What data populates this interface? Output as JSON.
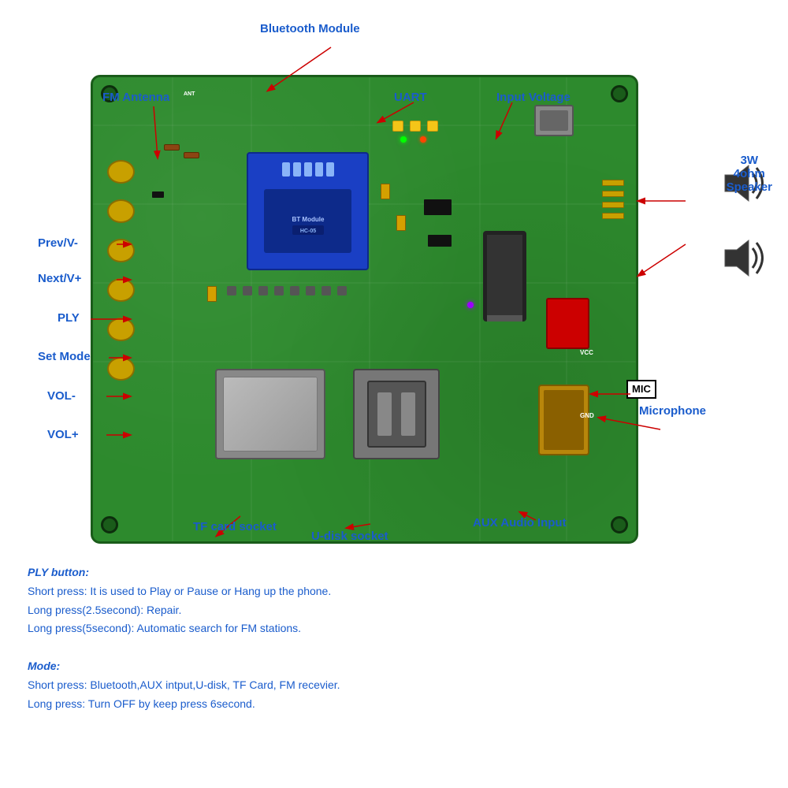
{
  "labels": {
    "bluetooth_module": "Bluetooth Module",
    "fm_antenna": "FM Antenna",
    "uart": "UART",
    "input_voltage": "Input Voltage",
    "prev_v_minus": "Prev/V-",
    "next_v_plus": "Next/V+",
    "ply": "PLY",
    "set_mode": "Set Mode",
    "vol_minus": "VOL-",
    "vol_plus": "VOL+",
    "speaker_label": "3W\n4ohm\nSpeaker",
    "speaker_line1": "3W",
    "speaker_line2": "4ohm",
    "speaker_line3": "Speaker",
    "mic_label": "MIC",
    "microphone": "Microphone",
    "tf_card_socket": "TF card socket",
    "u_disk_socket": "U-disk socket",
    "aux_audio_input": "AUX Audio Input"
  },
  "description": {
    "ply_button_title": "PLY button:",
    "ply_short_press": "Short press: It is used to Play or Pause or Hang up the phone.",
    "ply_long_press_1": "Long press(2.5second): Repair.",
    "ply_long_press_2": "Long press(5second): Automatic search for FM stations.",
    "mode_title": "Mode:",
    "mode_short_press": "Short press: Bluetooth,AUX intput,U-disk, TF Card, FM recevier.",
    "mode_long_press": "Long press: Turn OFF by keep press 6second."
  },
  "colors": {
    "label_blue": "#1a5ccc",
    "arrow_red": "#cc0000",
    "pcb_green": "#2d8a2d",
    "bt_blue": "#1a3fc4"
  }
}
